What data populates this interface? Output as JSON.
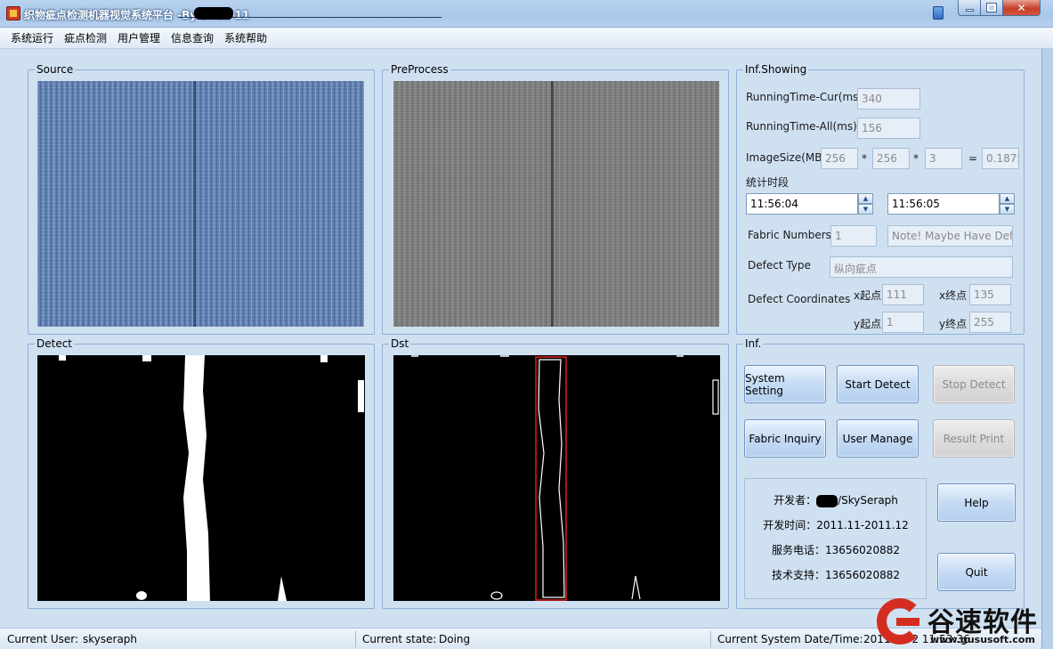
{
  "window": {
    "title": "织物疵点检测机器视觉系统平台 -By        2011-11"
  },
  "menu": [
    "系统运行",
    "疵点检测",
    "用户管理",
    "信息查询",
    "系统帮助"
  ],
  "panels": {
    "source": "Source",
    "preprocess": "PreProcess",
    "detect": "Detect",
    "dst": "Dst",
    "info_showing": "Inf.Showing",
    "inf": "Inf."
  },
  "info": {
    "running_time_cur_label": "RunningTime-Cur(ms)",
    "running_time_cur": "340",
    "running_time_all_label": "RunningTime-All(ms)",
    "running_time_all": "156",
    "image_size_label": "ImageSize(MB)",
    "image_w": "256",
    "image_h": "256",
    "image_c": "3",
    "image_mb": "0.1875",
    "mul1": "*",
    "mul2": "*",
    "eq": "=",
    "period_label": "统计时段",
    "time_start": "11:56:04",
    "time_end": "11:56:05",
    "fabric_numbers_label": "Fabric Numbers",
    "fabric_numbers": "1",
    "fabric_note": "Note! Maybe Have Defect",
    "defect_type_label": "Defect Type",
    "defect_type": "纵向疵点",
    "defect_coords_label": "Defect Coordinates",
    "x_start_label": "x起点",
    "x_start": "111",
    "x_end_label": "x终点",
    "x_end": "135",
    "y_start_label": "y起点",
    "y_start": "1",
    "y_end_label": "y终点",
    "y_end": "255"
  },
  "buttons": {
    "system_setting": "System Setting",
    "start_detect": "Start Detect",
    "stop_detect": "Stop Detect",
    "fabric_inquiry": "Fabric Inquiry",
    "user_manage": "User Manage",
    "result_print": "Result Print",
    "help": "Help",
    "quit": "Quit"
  },
  "developer": {
    "developer_prefix": "开发者：",
    "developer_name": "/SkySeraph",
    "dev_time": "开发时间：2011.11-2011.12",
    "service_phone": "服务电话：13656020882",
    "tech_support": "技术支持：13656020882"
  },
  "status": {
    "current_user_label": "Current User:",
    "current_user": "skyseraph",
    "current_state_label": "Current state:",
    "current_state": "Doing",
    "datetime_label": "Current System Date/Time:",
    "datetime": "2011-06-2 11:53:36"
  },
  "watermark": {
    "name": "谷速软件",
    "url": "www.gususoft.com"
  },
  "colors": {
    "accent": "#cfe0f1",
    "logo_red": "#d42d20",
    "defect_box": "#e02020"
  }
}
